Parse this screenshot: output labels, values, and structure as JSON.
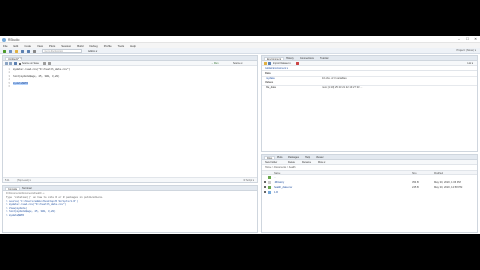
{
  "window": {
    "title": "RStudio",
    "minimize": "–",
    "maximize": "☐",
    "close": "✕"
  },
  "menu": [
    "File",
    "Edit",
    "Code",
    "View",
    "Plots",
    "Session",
    "Build",
    "Debug",
    "Profile",
    "Tools",
    "Help"
  ],
  "toolbar": {
    "goto_placeholder": "Go to file/function",
    "addins": "Addins ▾",
    "project": "Project: (None) ▾"
  },
  "editor": {
    "tab": "Untitled1*",
    "source_on_save": "Source on Save",
    "run": "→ Run",
    "source": "Source ▾",
    "lines": [
      "mydata<-read.csv(\"D:/health_data.csv\")",
      "",
      "hist(mydata$age, 25, 300, 3,20)",
      "",
      "mydata$BMI",
      ""
    ],
    "line_numbers": [
      "1",
      "2",
      "3",
      "4",
      "5",
      "6"
    ],
    "status_pos": "5:11",
    "status_scope": "(Top Level) ▾",
    "status_type": "R Script ▾"
  },
  "console": {
    "tab_console": "Console",
    "tab_terminal": "Terminal",
    "path": "D:/Documents/Documents/health/ ⇒",
    "lines": [
      "Type 'citation()' on how to cite R or R packages in publications.",
      "> source('C:/Users/admin/Desktop/R Scripts/1.R')",
      "> mydata<-read.csv(\"D:/health_data.csv\")",
      "> View(mydata)",
      "> hist(mydata$age, 25, 300, 3,20)",
      "> mydata$BMI"
    ]
  },
  "environment": {
    "tabs": [
      "Environment",
      "History",
      "Connections",
      "Tutorial"
    ],
    "import": "Import Dataset ▾",
    "global_env": "Global Environment ▾",
    "list_view": "List ▾",
    "section_data": "Data",
    "rows": [
      {
        "name": "mydata",
        "value": "10 obs. of 3 variables"
      }
    ],
    "section_values": "Values",
    "values": [
      {
        "name": "file_data",
        "value": "num [1:10] 25 23 21 22 19 27 33 ..."
      }
    ]
  },
  "files": {
    "tabs": [
      "Files",
      "Plots",
      "Packages",
      "Help",
      "Viewer"
    ],
    "actions": [
      "New Folder",
      "Delete",
      "Rename",
      "More ▾"
    ],
    "breadcrumb": "Home > Documents > health",
    "columns": [
      "Name",
      "Size",
      "Modified"
    ],
    "items": [
      {
        "name": "..",
        "size": "",
        "modified": ""
      },
      {
        "name": ".Rhistory",
        "size": "354 B",
        "modified": "May 30, 2020, 1:06 PM"
      },
      {
        "name": "health_data.csv",
        "size": "245 B",
        "modified": "May 30, 2020, 12:58 PM"
      },
      {
        "name": "1.R",
        "size": "",
        "modified": ""
      }
    ]
  }
}
